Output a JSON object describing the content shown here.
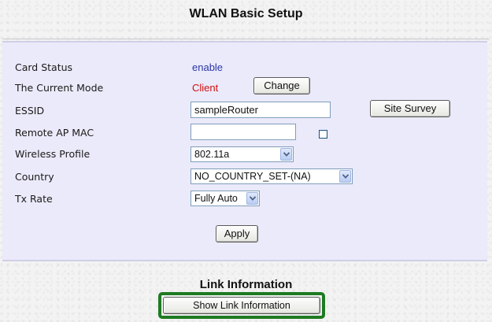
{
  "page": {
    "title": "WLAN Basic Setup"
  },
  "form": {
    "card_status": {
      "label": "Card Status",
      "value": "enable"
    },
    "current_mode": {
      "label": "The Current Mode",
      "value": "Client",
      "button": "Change"
    },
    "essid": {
      "label": "ESSID",
      "value": "sampleRouter",
      "button": "Site Survey"
    },
    "remote_ap_mac": {
      "label": "Remote AP MAC",
      "value": "",
      "checked": false
    },
    "wireless_profile": {
      "label": "Wireless Profile",
      "selected": "802.11a"
    },
    "country": {
      "label": "Country",
      "selected": "NO_COUNTRY_SET-(NA)"
    },
    "tx_rate": {
      "label": "Tx Rate",
      "selected": "Fully Auto"
    },
    "apply_button": "Apply"
  },
  "link_info": {
    "title": "Link Information",
    "button": "Show Link Information"
  },
  "colors": {
    "panel_bg": "#ebeafa",
    "value_blue": "#2a37a8",
    "value_red": "#d01010",
    "highlight": "#1f7a22"
  },
  "icons": [
    "chevron-down-icon",
    "checkbox-icon"
  ]
}
